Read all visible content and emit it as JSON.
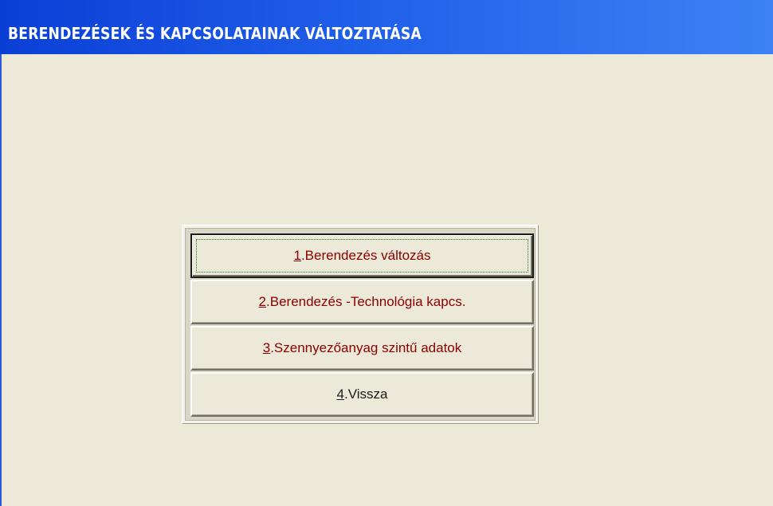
{
  "window": {
    "title": "BERENDEZÉSEK ÉS KAPCSOLATAINAK VÁLTOZTATÁSA"
  },
  "menu": {
    "items": [
      {
        "hotkey": "1",
        "label": ".Berendezés változás",
        "focused": true
      },
      {
        "hotkey": "2",
        "label": ".Berendezés -Technológia kapcs.",
        "focused": false
      },
      {
        "hotkey": "3",
        "label": ".Szennyezőanyag szintű adatok",
        "focused": false
      },
      {
        "hotkey": "4",
        "label": ".Vissza",
        "focused": false
      }
    ]
  },
  "colors": {
    "window_background": "#ece9d8",
    "title_bar_start": "#0a3fd6",
    "title_bar_end": "#3c82f6",
    "menu_text": "#8b0000",
    "back_text": "#1a1a1a"
  }
}
